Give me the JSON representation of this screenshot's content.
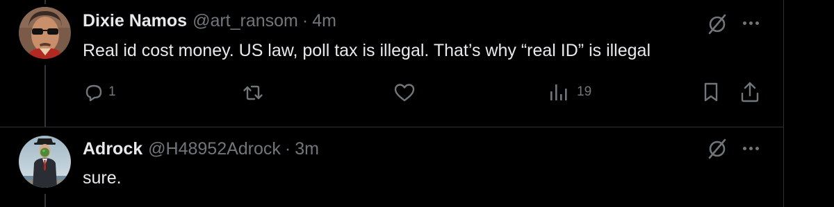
{
  "tweets": [
    {
      "display_name": "Dixie Namos",
      "handle": "@art_ransom",
      "separator": "·",
      "time": "4m",
      "text": "Real id cost money. US law, poll tax is illegal. That’s why “real ID” is illegal",
      "replies": "1",
      "views": "19",
      "avatar": "man-with-sunglasses-avatar"
    },
    {
      "display_name": "Adrock",
      "handle": "@H48952Adrock",
      "separator": "·",
      "time": "3m",
      "text": "sure.",
      "avatar": "son-of-man-painting-avatar"
    }
  ],
  "icons": {
    "grok": "grok-slash-icon",
    "more": "more-dots-icon",
    "reply": "reply-bubble-icon",
    "retweet": "retweet-icon",
    "like": "heart-icon",
    "views": "analytics-bars-icon",
    "bookmark": "bookmark-icon",
    "share": "share-icon"
  },
  "colors": {
    "background": "#000000",
    "text_primary": "#e7e9ea",
    "text_secondary": "#71767b",
    "border": "#2f3336"
  }
}
